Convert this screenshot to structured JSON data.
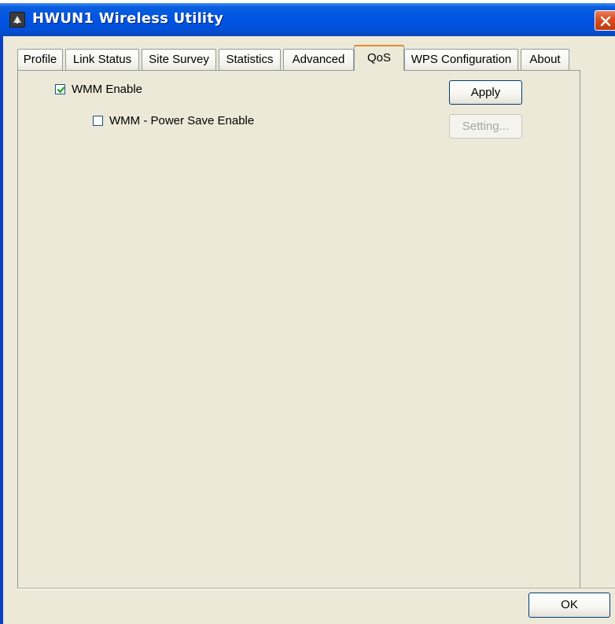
{
  "window": {
    "title": "HWUN1 Wireless Utility",
    "titlebar_color": "#0054e3",
    "close_button_color": "#d84c1f"
  },
  "tabs": [
    {
      "label": "Profile",
      "active": false
    },
    {
      "label": "Link Status",
      "active": false
    },
    {
      "label": "Site Survey",
      "active": false
    },
    {
      "label": "Statistics",
      "active": false
    },
    {
      "label": "Advanced",
      "active": false
    },
    {
      "label": "QoS",
      "active": true
    },
    {
      "label": "WPS Configuration",
      "active": false
    },
    {
      "label": "About",
      "active": false
    }
  ],
  "qos": {
    "wmm_enable": {
      "label": "WMM Enable",
      "checked": true
    },
    "wmm_power_save": {
      "label": "WMM - Power Save Enable",
      "checked": false
    },
    "apply_label": "Apply",
    "setting_label": "Setting...",
    "setting_enabled": false
  },
  "footer": {
    "ok_label": "OK"
  },
  "icons": {
    "app": "wireless-app-icon",
    "close": "close-icon",
    "check": "checkmark-icon"
  }
}
